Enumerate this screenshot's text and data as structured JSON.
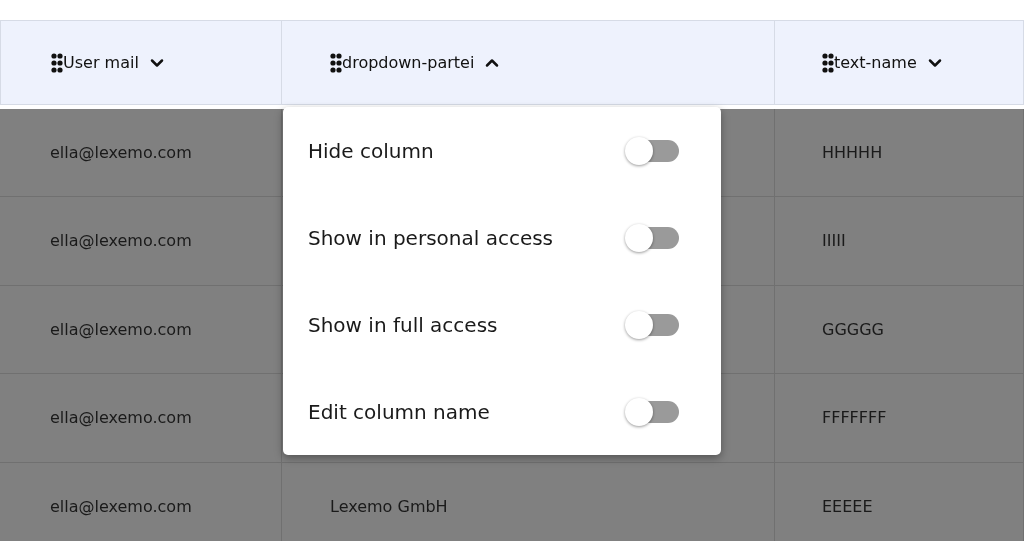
{
  "table": {
    "columns": [
      {
        "label": "User mail",
        "expanded": false
      },
      {
        "label": "dropdown-partei",
        "expanded": true
      },
      {
        "label": "text-name",
        "expanded": false
      }
    ],
    "rows": [
      {
        "user_mail": "ella@lexemo.com",
        "text_name": "HHHHH"
      },
      {
        "user_mail": "ella@lexemo.com",
        "text_name": "IIIII"
      },
      {
        "user_mail": "ella@lexemo.com",
        "text_name": "GGGGG"
      },
      {
        "user_mail": "ella@lexemo.com",
        "text_name": "FFFFFFF"
      },
      {
        "user_mail": "ella@lexemo.com",
        "dropdown_partei": "Lexemo GmbH",
        "text_name": "EEEEE"
      }
    ]
  },
  "column_menu": {
    "items": [
      {
        "label": "Hide column",
        "on": false
      },
      {
        "label": "Show in personal access",
        "on": false
      },
      {
        "label": "Show in full access",
        "on": false
      },
      {
        "label": "Edit column name",
        "on": false
      }
    ]
  }
}
